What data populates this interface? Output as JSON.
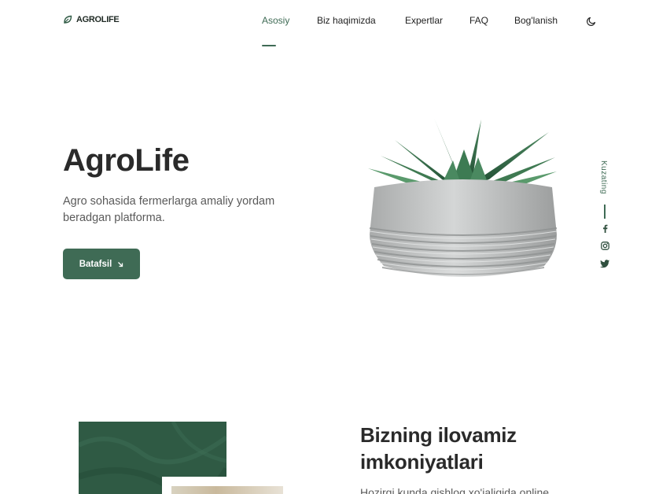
{
  "brand": {
    "name": "AGROLIFE"
  },
  "nav": {
    "items": [
      {
        "label": "Asosiy",
        "active": true
      },
      {
        "label": "Biz haqimizda",
        "active": false
      },
      {
        "label": "Expertlar",
        "active": false
      },
      {
        "label": "FAQ",
        "active": false
      },
      {
        "label": "Bog'lanish",
        "active": false
      }
    ],
    "theme_icon": "moon-icon"
  },
  "hero": {
    "title": "AgroLife",
    "subtitle": "Agro sohasida fermerlarga amaliy yordam beradgan platforma.",
    "button_label": "Batafsil",
    "button_icon": "arrow-down-right-icon"
  },
  "social": {
    "follow_label": "Kuzating",
    "icons": [
      "facebook-icon",
      "instagram-icon",
      "twitter-icon"
    ]
  },
  "features": {
    "title": "Bizning ilovamiz imkoniyatlari",
    "text": "Hozirgi kunda qishloq xo'jaligida online"
  },
  "colors": {
    "accent": "#3f6b55",
    "text": "#2a2a2a",
    "muted": "#5a5a5a"
  }
}
